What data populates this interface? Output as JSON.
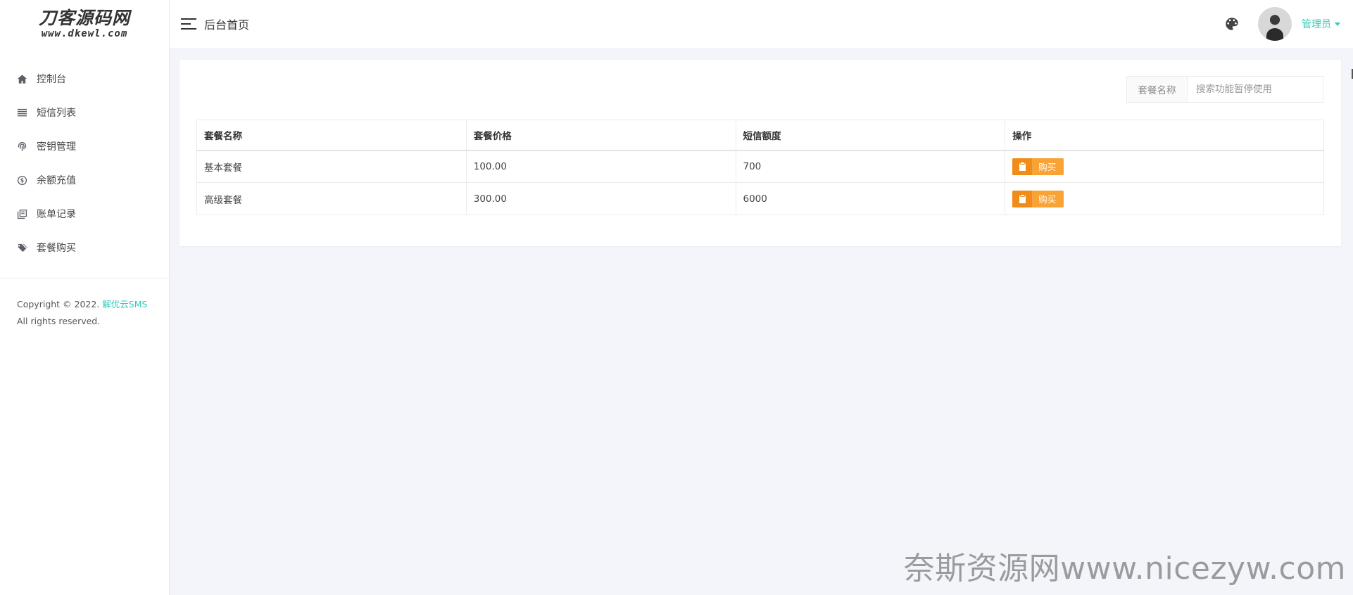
{
  "logo": {
    "line1": "刀客源码网",
    "line2": "www.dkewl.com"
  },
  "sidebar": {
    "items": [
      {
        "label": "控制台",
        "icon": "home-icon"
      },
      {
        "label": "短信列表",
        "icon": "list-icon"
      },
      {
        "label": "密钥管理",
        "icon": "fingerprint-icon"
      },
      {
        "label": "余额充值",
        "icon": "dollar-circle-icon"
      },
      {
        "label": "账单记录",
        "icon": "book-icon"
      },
      {
        "label": "套餐购买",
        "icon": "tags-icon"
      }
    ],
    "copyright_prefix": "Copyright © 2022.",
    "copyright_link": "解优云SMS",
    "copyright_suffix": "All rights reserved."
  },
  "header": {
    "title": "后台首页",
    "user_name": "管理员"
  },
  "search": {
    "label": "套餐名称",
    "placeholder": "搜索功能暂停使用"
  },
  "table": {
    "headers": [
      "套餐名称",
      "套餐价格",
      "短信额度",
      "操作"
    ],
    "rows": [
      {
        "name": "基本套餐",
        "price": "100.00",
        "quota": "700",
        "action": "购买"
      },
      {
        "name": "高级套餐",
        "price": "300.00",
        "quota": "6000",
        "action": "购买"
      }
    ]
  },
  "watermark": "奈斯资源网www.nicezyw.com",
  "colors": {
    "accent": "#33cabb",
    "button": "#f9a236"
  }
}
